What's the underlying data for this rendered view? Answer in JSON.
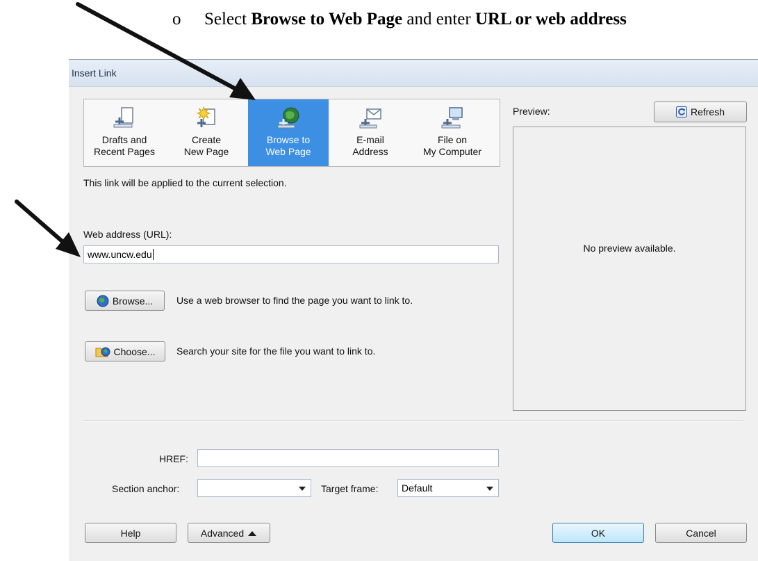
{
  "document": {
    "bullet": "o",
    "text_before": "Select ",
    "bold_1": "Browse to Web Page",
    "text_mid": " and enter ",
    "bold_2": "URL or web address"
  },
  "dialog": {
    "title": "Insert Link",
    "tabs": [
      {
        "line1": "Drafts and",
        "line2": "Recent Pages",
        "icon": "drafts-pages-icon",
        "selected": false
      },
      {
        "line1": "Create",
        "line2": "New Page",
        "icon": "new-page-icon",
        "selected": false
      },
      {
        "line1": "Browse to",
        "line2": "Web Page",
        "icon": "web-page-globe-icon",
        "selected": true
      },
      {
        "line1": "E-mail",
        "line2": "Address",
        "icon": "email-icon",
        "selected": false
      },
      {
        "line1": "File on",
        "line2": "My Computer",
        "icon": "computer-file-icon",
        "selected": false
      }
    ],
    "selection_note": "This link will be applied to the current selection.",
    "url_label": "Web address (URL):",
    "url_value": "www.uncw.edu",
    "browse_button": "Browse...",
    "browse_desc": "Use a web browser to find the page you want to link to.",
    "choose_button": "Choose...",
    "choose_desc": "Search your site for the file you want to link to.",
    "preview_label": "Preview:",
    "refresh_button": "Refresh",
    "preview_text": "No preview available.",
    "href_label": "HREF:",
    "href_value": "",
    "section_anchor_label": "Section anchor:",
    "section_anchor_value": "",
    "target_frame_label": "Target frame:",
    "target_frame_value": "Default",
    "help_button": "Help",
    "advanced_button": "Advanced",
    "ok_button": "OK",
    "cancel_button": "Cancel"
  },
  "colors": {
    "selected_tab": "#3d8fe3",
    "arrow": "#111111"
  }
}
